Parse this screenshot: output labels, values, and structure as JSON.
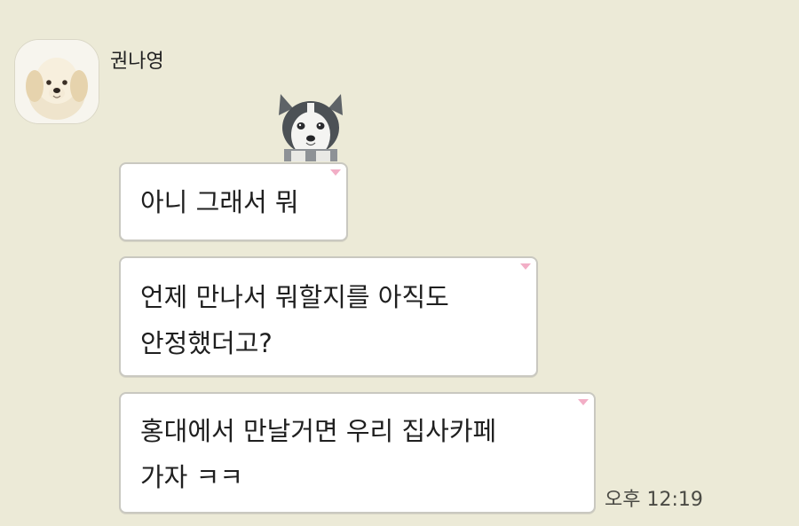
{
  "chat": {
    "sender_name": "권나영",
    "messages": [
      {
        "lines": [
          "아니 그래서 뭐"
        ]
      },
      {
        "lines": [
          "언제 만나서 뭐할지를 아직도",
          "안정했더고?"
        ]
      },
      {
        "lines": [
          "홍대에서 만날거면 우리 집사카페",
          "가자 ㅋㅋ"
        ]
      }
    ],
    "timestamp": "오후 12:19"
  },
  "icons": {
    "avatar": "golden-puppy-avatar",
    "sticker": "husky-puppy-sticker"
  },
  "colors": {
    "background": "#ecead7",
    "bubble_background": "#ffffff",
    "bubble_border": "#c9c8c0",
    "bubble_corner_marker": "#f2aec6"
  }
}
